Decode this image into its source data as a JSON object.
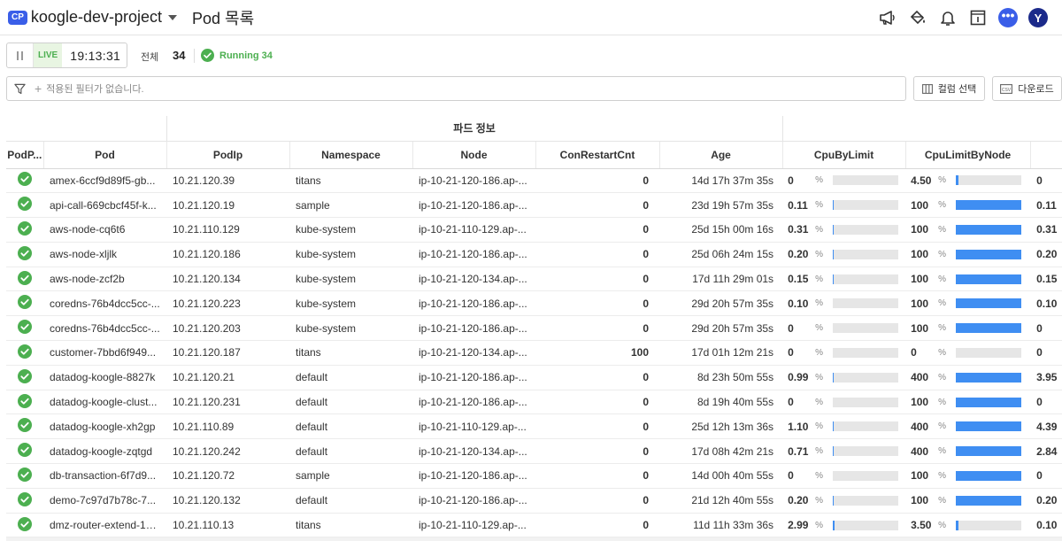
{
  "header": {
    "badge": "CP",
    "project": "koogle-dev-project",
    "title": "Pod 목록",
    "icons": [
      "megaphone-icon",
      "paint-bucket-icon",
      "bell-icon",
      "info-panel-icon",
      "more-dots-icon",
      "user-avatar"
    ],
    "avatar_initial": "Y",
    "dots": "•••"
  },
  "toolbar": {
    "live_label": "LIVE",
    "time": "19:13:31",
    "total_label": "전체",
    "total_count": "34",
    "running_label": "Running 34"
  },
  "filter": {
    "placeholder": "적용된 필터가 없습니다.",
    "column_select": "컬럼 선택",
    "download": "다운로드",
    "csv_badge": "CSV"
  },
  "table": {
    "group_header": "파드 정보",
    "columns": [
      "PodP...",
      "Pod",
      "PodIp",
      "Namespace",
      "Node",
      "ConRestartCnt",
      "Age",
      "CpuByLimit",
      "CpuLimitByNode"
    ],
    "percent_unit": "%",
    "rows": [
      {
        "pod": "amex-6ccf9d89f5-gb...",
        "ip": "10.21.120.39",
        "ns": "titans",
        "node": "ip-10-21-120-186.ap-...",
        "restart": "0",
        "age": "14d 17h 37m 35s",
        "cpu_limit": "0",
        "cpu_limit_pct": 0,
        "cpu_node": "4.50",
        "cpu_node_pct": 4.5,
        "cut": "0"
      },
      {
        "pod": "api-call-669cbcf45f-k...",
        "ip": "10.21.120.19",
        "ns": "sample",
        "node": "ip-10-21-120-186.ap-...",
        "restart": "0",
        "age": "23d 19h 57m 35s",
        "cpu_limit": "0.11",
        "cpu_limit_pct": 0.11,
        "cpu_node": "100",
        "cpu_node_pct": 100,
        "cut": "0.11"
      },
      {
        "pod": "aws-node-cq6t6",
        "ip": "10.21.110.129",
        "ns": "kube-system",
        "node": "ip-10-21-110-129.ap-...",
        "restart": "0",
        "age": "25d 15h 00m 16s",
        "cpu_limit": "0.31",
        "cpu_limit_pct": 0.31,
        "cpu_node": "100",
        "cpu_node_pct": 100,
        "cut": "0.31"
      },
      {
        "pod": "aws-node-xljlk",
        "ip": "10.21.120.186",
        "ns": "kube-system",
        "node": "ip-10-21-120-186.ap-...",
        "restart": "0",
        "age": "25d 06h 24m 15s",
        "cpu_limit": "0.20",
        "cpu_limit_pct": 0.2,
        "cpu_node": "100",
        "cpu_node_pct": 100,
        "cut": "0.20"
      },
      {
        "pod": "aws-node-zcf2b",
        "ip": "10.21.120.134",
        "ns": "kube-system",
        "node": "ip-10-21-120-134.ap-...",
        "restart": "0",
        "age": "17d 11h 29m 01s",
        "cpu_limit": "0.15",
        "cpu_limit_pct": 0.15,
        "cpu_node": "100",
        "cpu_node_pct": 100,
        "cut": "0.15"
      },
      {
        "pod": "coredns-76b4dcc5cc-...",
        "ip": "10.21.120.223",
        "ns": "kube-system",
        "node": "ip-10-21-120-186.ap-...",
        "restart": "0",
        "age": "29d 20h 57m 35s",
        "cpu_limit": "0.10",
        "cpu_limit_pct": 0.1,
        "cpu_node": "100",
        "cpu_node_pct": 100,
        "cut": "0.10"
      },
      {
        "pod": "coredns-76b4dcc5cc-...",
        "ip": "10.21.120.203",
        "ns": "kube-system",
        "node": "ip-10-21-120-186.ap-...",
        "restart": "0",
        "age": "29d 20h 57m 35s",
        "cpu_limit": "0",
        "cpu_limit_pct": 0,
        "cpu_node": "100",
        "cpu_node_pct": 100,
        "cut": "0"
      },
      {
        "pod": "customer-7bbd6f949...",
        "ip": "10.21.120.187",
        "ns": "titans",
        "node": "ip-10-21-120-134.ap-...",
        "restart": "100",
        "age": "17d 01h 12m 21s",
        "cpu_limit": "0",
        "cpu_limit_pct": 0,
        "cpu_node": "0",
        "cpu_node_pct": 0,
        "cut": "0"
      },
      {
        "pod": "datadog-koogle-8827k",
        "ip": "10.21.120.21",
        "ns": "default",
        "node": "ip-10-21-120-186.ap-...",
        "restart": "0",
        "age": "8d 23h 50m 55s",
        "cpu_limit": "0.99",
        "cpu_limit_pct": 0.99,
        "cpu_node": "400",
        "cpu_node_pct": 100,
        "cut": "3.95"
      },
      {
        "pod": "datadog-koogle-clust...",
        "ip": "10.21.120.231",
        "ns": "default",
        "node": "ip-10-21-120-186.ap-...",
        "restart": "0",
        "age": "8d 19h 40m 55s",
        "cpu_limit": "0",
        "cpu_limit_pct": 0,
        "cpu_node": "100",
        "cpu_node_pct": 100,
        "cut": "0"
      },
      {
        "pod": "datadog-koogle-xh2gp",
        "ip": "10.21.110.89",
        "ns": "default",
        "node": "ip-10-21-110-129.ap-...",
        "restart": "0",
        "age": "25d 12h 13m 36s",
        "cpu_limit": "1.10",
        "cpu_limit_pct": 1.1,
        "cpu_node": "400",
        "cpu_node_pct": 100,
        "cut": "4.39"
      },
      {
        "pod": "datadog-koogle-zqtgd",
        "ip": "10.21.120.242",
        "ns": "default",
        "node": "ip-10-21-120-134.ap-...",
        "restart": "0",
        "age": "17d 08h 42m 21s",
        "cpu_limit": "0.71",
        "cpu_limit_pct": 0.71,
        "cpu_node": "400",
        "cpu_node_pct": 100,
        "cut": "2.84"
      },
      {
        "pod": "db-transaction-6f7d9...",
        "ip": "10.21.120.72",
        "ns": "sample",
        "node": "ip-10-21-120-186.ap-...",
        "restart": "0",
        "age": "14d 00h 40m 55s",
        "cpu_limit": "0",
        "cpu_limit_pct": 0,
        "cpu_node": "100",
        "cpu_node_pct": 100,
        "cut": "0"
      },
      {
        "pod": "demo-7c97d7b78c-7...",
        "ip": "10.21.120.132",
        "ns": "default",
        "node": "ip-10-21-120-186.ap-...",
        "restart": "0",
        "age": "21d 12h 40m 55s",
        "cpu_limit": "0.20",
        "cpu_limit_pct": 0.2,
        "cpu_node": "100",
        "cpu_node_pct": 100,
        "cut": "0.20"
      },
      {
        "pod": "dmz-router-extend-13...",
        "ip": "10.21.110.13",
        "ns": "titans",
        "node": "ip-10-21-110-129.ap-...",
        "restart": "0",
        "age": "11d 11h 33m 36s",
        "cpu_limit": "2.99",
        "cpu_limit_pct": 2.99,
        "cpu_node": "3.50",
        "cpu_node_pct": 3.5,
        "cut": "0.10"
      }
    ]
  },
  "colors": {
    "accent": "#3a5ee8",
    "running": "#4caf50",
    "bar": "#3f8ef2",
    "bar_track": "#e6e6e6"
  }
}
